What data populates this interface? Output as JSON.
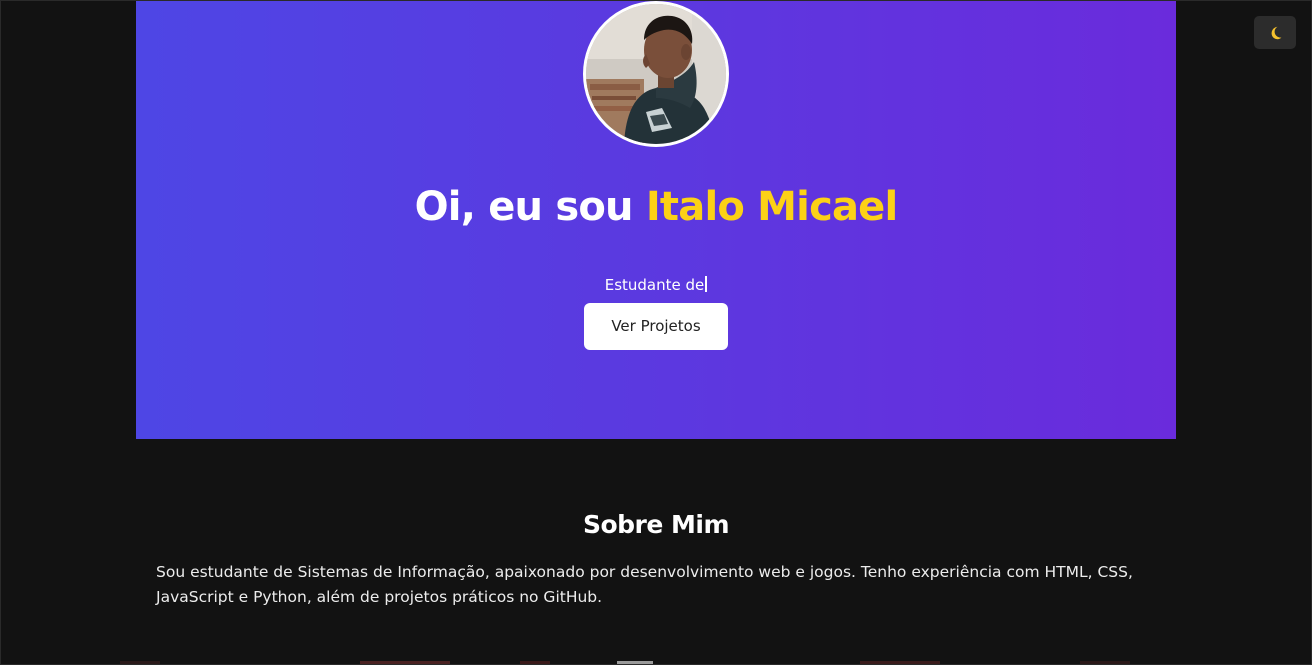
{
  "hero": {
    "greeting": "Oi, eu sou ",
    "name": "Italo Micael",
    "typing_text": "Estudante de",
    "cta_label": "Ver Projetos"
  },
  "theme_toggle": {
    "icon": "moon-icon"
  },
  "about": {
    "title": "Sobre Mim",
    "text": "Sou estudante de Sistemas de Informação, apaixonado por desenvolvimento web e jogos. Tenho experiência com HTML, CSS, JavaScript e Python, além de projetos práticos no GitHub."
  },
  "colors": {
    "background": "#121212",
    "hero_gradient_start": "#4e46e5",
    "hero_gradient_end": "#6a2bdc",
    "name_accent": "#fcd116",
    "button_bg": "#ffffff"
  }
}
